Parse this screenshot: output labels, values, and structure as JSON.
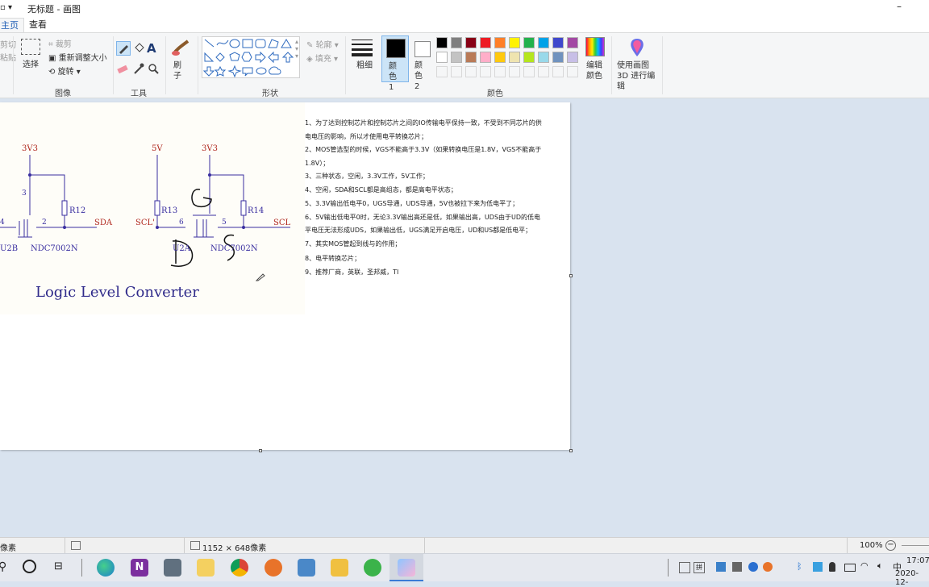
{
  "window": {
    "title": "无标题 - 画图"
  },
  "tabs": [
    "主页",
    "查看"
  ],
  "ribbon": {
    "clipboard": {
      "cut": "剪切",
      "paste": "粘贴"
    },
    "image": {
      "label": "图像",
      "select": "选择",
      "crop": "裁剪",
      "resize": "重新调整大小",
      "rotate": "旋转"
    },
    "tools": {
      "label": "工具"
    },
    "brushes": {
      "label": "刷子"
    },
    "shapes": {
      "label": "形状",
      "outline": "轮廓",
      "fill": "填充"
    },
    "size": {
      "label": "粗细"
    },
    "color1": {
      "label": "颜色 1"
    },
    "color2": {
      "label": "颜色 2"
    },
    "colors": {
      "label": "颜色"
    },
    "edit_colors": {
      "label": "编辑颜色"
    },
    "paint3d": {
      "label": "使用画图 3D 进行编辑"
    },
    "palette_row1": [
      "#000000",
      "#7f7f7f",
      "#880015",
      "#ed1c24",
      "#ff7f27",
      "#fff200",
      "#22b14c",
      "#00a2e8",
      "#3f48cc",
      "#a349a4"
    ],
    "palette_row2": [
      "#ffffff",
      "#c3c3c3",
      "#b97a57",
      "#ffaec9",
      "#ffc90e",
      "#efe4b0",
      "#b5e61d",
      "#99d9ea",
      "#7092be",
      "#c8bfe7"
    ]
  },
  "schematic": {
    "v3_left": "3V3",
    "v5": "5V",
    "v3_right": "3V3",
    "pin3": "3",
    "pin4": "4",
    "pin2": "2",
    "r12": "R12",
    "sda": "SDA",
    "u2b": "U2B",
    "ndc_left": "NDC7002N",
    "r13": "R13",
    "scl_prime": "SCL'",
    "pin6": "6",
    "pin5": "5",
    "r14": "R14",
    "scl": "SCL",
    "u2a": "U2A",
    "ndc_right": "NDC7002N",
    "handwritten_g": "G",
    "handwritten_d": "D",
    "handwritten_s": "S",
    "title": "Logic Level Converter"
  },
  "notes": [
    "1、为了达到控制芯片和控制芯片之间的IO传输电平保持一致，不受到不同芯片的供",
    "电电压的影响，所以才使用电平转换芯片；",
    "2、MOS管选型的时候，VGS不能高于3.3V（如果转换电压是1.8V，VGS不能高于",
    "1.8V）；",
    "3、三种状态，空闲，3.3V工作，5V工作；",
    "4、空闲，SDA和SCL都是高组态，都是高电平状态；",
    "5、3.3V输出低电平0，UGS导通，UDS导通，5V也被拉下来为低电平了；",
    "6、5V输出低电平0时，无论3.3V输出高还是低，如果输出高，UDS由于UD的低电",
    "平电压无法形成UDS，如果输出低，UGS满足开启电压，UD和US都是低电平；",
    "7、其实MOS管起到线与的作用；",
    "8、电平转换芯片；",
    "9、推荐厂商，英联，圣邦威，TI"
  ],
  "status": {
    "pixels": "像素",
    "size": "1152 × 648像素",
    "zoom": "100%"
  },
  "taskbar": {
    "time": "17:07",
    "date": "2020-12-"
  }
}
